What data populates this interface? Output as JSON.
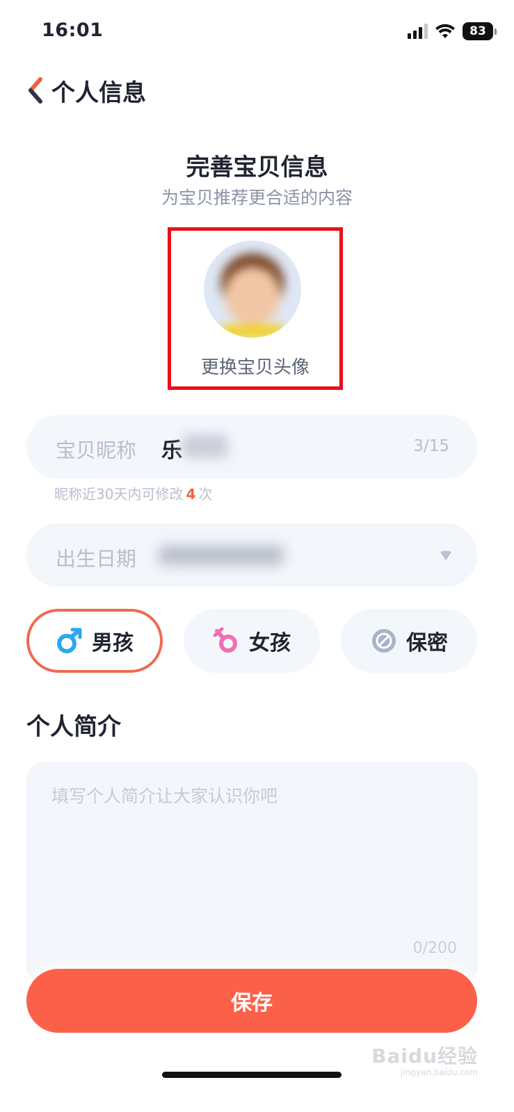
{
  "status_bar": {
    "time": "16:01",
    "battery": "83",
    "icons": [
      "signal-icon",
      "wifi-icon",
      "battery-icon"
    ]
  },
  "header": {
    "back_icon": "chevron-left-icon",
    "title": "个人信息"
  },
  "profile_section": {
    "title": "完善宝贝信息",
    "subtitle": "为宝贝推荐更合适的内容",
    "change_avatar_label": "更换宝贝头像"
  },
  "nickname": {
    "label": "宝贝昵称",
    "value": "乐",
    "count": "3/15",
    "hint_prefix": "昵称近30天内可修改",
    "hint_number": "4",
    "hint_suffix": "次"
  },
  "birthday": {
    "label": "出生日期",
    "dropdown_icon": "triangle-down-icon"
  },
  "gender": {
    "options": [
      {
        "label": "男孩",
        "icon": "male-icon",
        "color": "#2aa8f0",
        "selected": true
      },
      {
        "label": "女孩",
        "icon": "female-icon",
        "color": "#f06fb4",
        "selected": false
      },
      {
        "label": "保密",
        "icon": "prohibited-icon",
        "color": "#a9b4c7",
        "selected": false
      }
    ]
  },
  "bio": {
    "title": "个人简介",
    "placeholder": "填写个人简介让大家认识你吧",
    "count": "0/200"
  },
  "actions": {
    "save_label": "保存"
  },
  "watermark": {
    "text": "Baidu经验",
    "sub": "jingyan.baidu.com"
  },
  "colors": {
    "accent": "#fb6149",
    "highlight_border": "#e8101a",
    "field_bg": "#f3f6fb"
  }
}
